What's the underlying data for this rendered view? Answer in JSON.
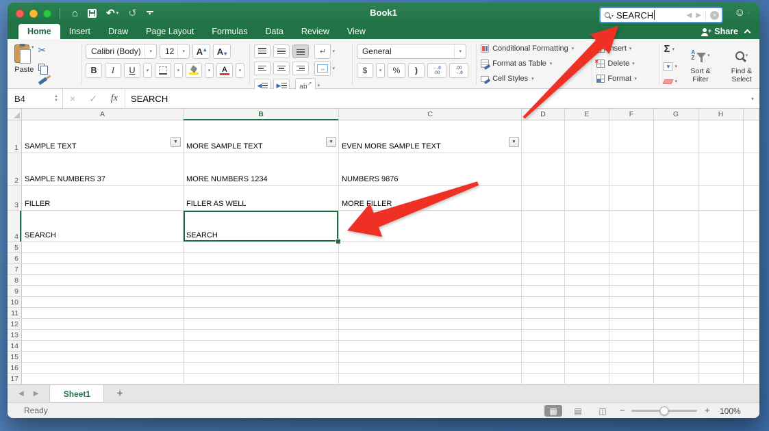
{
  "window": {
    "title": "Book1"
  },
  "titlebar": {
    "search": {
      "value": "SEARCH"
    },
    "share_label": "Share"
  },
  "tabs": [
    "Home",
    "Insert",
    "Draw",
    "Page Layout",
    "Formulas",
    "Data",
    "Review",
    "View"
  ],
  "active_tab": "Home",
  "ribbon": {
    "clipboard": {
      "paste": "Paste"
    },
    "font": {
      "family": "Calibri (Body)",
      "size": "12",
      "bold": "B",
      "italic": "I",
      "underline": "U",
      "grow": "A",
      "shrink": "A"
    },
    "alignment": {
      "orientation": "ab"
    },
    "number": {
      "format": "General",
      "currency": "$",
      "percent": "%",
      "comma": ")",
      "inc_top": "←.0",
      "inc_bot": ".00",
      "dec_top": ".00",
      "dec_bot": "→.0"
    },
    "styles": {
      "conditional": "Conditional Formatting",
      "table": "Format as Table",
      "cell": "Cell Styles"
    },
    "cells": {
      "insert": "Insert",
      "delete": "Delete",
      "format": "Format"
    },
    "editing": {
      "autosum": "Σ",
      "sort_line1": "Sort &",
      "sort_line2": "Filter",
      "find_line1": "Find &",
      "find_line2": "Select"
    }
  },
  "formula_bar": {
    "cell_ref": "B4",
    "fx": "fx",
    "value": "SEARCH"
  },
  "grid": {
    "columns": [
      "A",
      "B",
      "C",
      "D",
      "E",
      "F",
      "G",
      "H"
    ],
    "selected_cell": "B4",
    "selected_col": "B",
    "selected_row": "4",
    "rows": [
      {
        "n": "1",
        "cells": {
          "A": "SAMPLE TEXT",
          "B": "MORE SAMPLE TEXT",
          "C": "EVEN MORE SAMPLE TEXT"
        },
        "filters": [
          "A",
          "B",
          "C"
        ]
      },
      {
        "n": "2",
        "cells": {
          "A": "SAMPLE NUMBERS 37",
          "B": "MORE NUMBERS 1234",
          "C": "NUMBERS 9876"
        }
      },
      {
        "n": "3",
        "cells": {
          "A": "FILLER",
          "B": "FILLER AS WELL",
          "C": "MORE FILLER"
        }
      },
      {
        "n": "4",
        "cells": {
          "A": "SEARCH",
          "B": "SEARCH"
        }
      },
      {
        "n": "5"
      },
      {
        "n": "6"
      },
      {
        "n": "7"
      },
      {
        "n": "8"
      },
      {
        "n": "9"
      },
      {
        "n": "10"
      },
      {
        "n": "11"
      },
      {
        "n": "12"
      },
      {
        "n": "13"
      },
      {
        "n": "14"
      },
      {
        "n": "15"
      },
      {
        "n": "16"
      },
      {
        "n": "17"
      }
    ]
  },
  "sheet_tabs": {
    "active": "Sheet1",
    "add_label": "+"
  },
  "status_bar": {
    "mode": "Ready",
    "zoom_level": "100%"
  },
  "icons": {
    "home": "⌂",
    "undo": "↶",
    "redo": "↺",
    "dropdown": "▾",
    "stepper_up": "▲",
    "stepper_down": "▼",
    "close": "×",
    "check": "✓",
    "scissors": "✂",
    "left": "◀",
    "right": "▶",
    "smiley": "☺",
    "wrap": "↵",
    "merge": "↔",
    "indent_left": "◀",
    "indent_right": "▶",
    "orient_arrow": "↗",
    "filldown": "▼",
    "grid_view": "▦",
    "layout_view": "▤",
    "break_view": "◫",
    "minus": "−",
    "plus": "+"
  },
  "colors": {
    "excel_green": "#217346",
    "selection_green": "#1e6b41",
    "arrow_red": "#ee3124"
  }
}
